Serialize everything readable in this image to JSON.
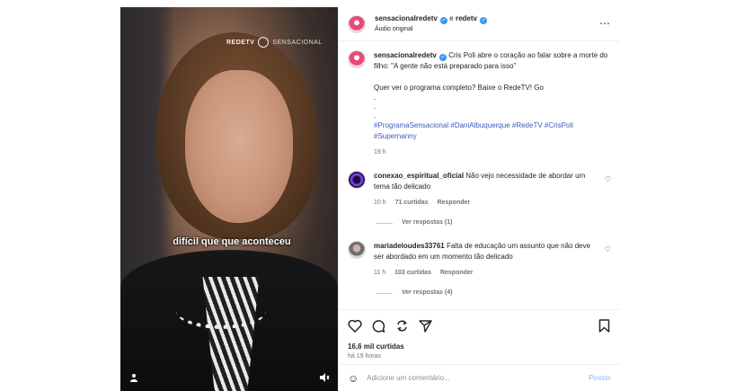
{
  "media": {
    "brand": "REDETV",
    "brand_sub": "SENSACIONAL",
    "caption": "difícil que que aconteceu",
    "icons": [
      "user-icon",
      "speaker-icon"
    ]
  },
  "header": {
    "username": "sensacionalredetv",
    "connector": "e",
    "collab": "redetv",
    "audio": "Áudio original",
    "more": "⋯"
  },
  "post": {
    "username": "sensacionalredetv",
    "text": "Cris Poli abre o coração ao falar sobre a morte do filho: \"A gente não está preparado para isso\"",
    "cta": "Quer ver o programa completo? Baixe o RedeTV! Go",
    "dots": [
      ".",
      ".",
      "."
    ],
    "hashtags": "#ProgramaSensacional #DaniAlbuquerque #RedeTV #CrisPoli #Supernanny",
    "time": "19 h"
  },
  "comments": [
    {
      "username": "conexao_espiritual_oficial",
      "text": "Não vejo necessidade de abordar um tema tão delicado",
      "time": "10 h",
      "likes": "71 curtidas",
      "reply": "Responder",
      "view_replies": "Ver respostas (1)"
    },
    {
      "username": "mariadeloudes33761",
      "text": "Falta de educação um assunto que não deve ser abordado em um momento tão delicado",
      "time": "11 h",
      "likes": "103 curtidas",
      "reply": "Responder",
      "view_replies": "Ver respostas (4)"
    }
  ],
  "actions": {
    "likes": "16,6 mil curtidas",
    "ago": "há 19 horas",
    "icons": [
      "heart-icon",
      "comment-icon",
      "share-icon",
      "send-icon",
      "bookmark-icon"
    ]
  },
  "composer": {
    "placeholder": "Adicione um comentário...",
    "post": "Postar"
  }
}
